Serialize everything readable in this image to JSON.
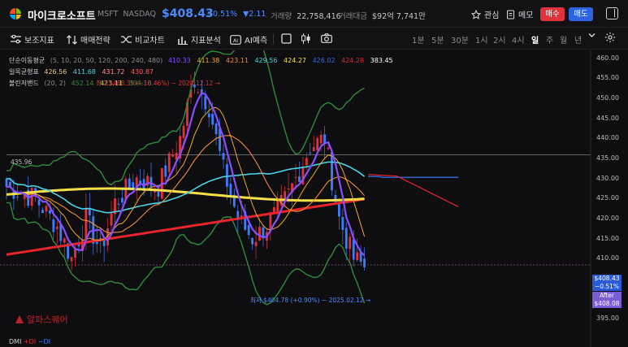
{
  "header": {
    "name": "마이크로소프트",
    "symbol": "MSFT",
    "exchange": "NASDAQ",
    "price": "$408.43",
    "change_pct": "−0.51%",
    "change_abs": "▼2.11",
    "volume_label": "거래량",
    "volume_value": "22,758,416",
    "amount_label": "거래대금",
    "amount_value": "$92억 7,741만",
    "watch_label": "관심",
    "memo_label": "메모",
    "buy_label": "매수",
    "sell_label": "매도"
  },
  "toolbar": {
    "aux_indicator": "보조지표",
    "trade_strategy": "매매전략",
    "compare_chart": "비교차트",
    "indicator_analysis": "지표분석",
    "ai_forecast": "AI예측",
    "timeframes": [
      "1분",
      "5분",
      "30분",
      "1시",
      "2시",
      "4시",
      "일",
      "주",
      "월",
      "년"
    ],
    "active_timeframe": "일"
  },
  "legend": {
    "sma": {
      "name": "단순이동평균",
      "params": "(5, 10, 20, 50, 120, 200, 240, 480)",
      "values": [
        "410.33",
        "411.38",
        "423.11",
        "429.56",
        "424.27",
        "426.02",
        "424.28",
        "383.45"
      ]
    },
    "ichimoku": {
      "name": "일목균형표",
      "values": [
        "426.56",
        "411.68",
        "431.72",
        "430.87"
      ]
    },
    "bollinger": {
      "name": "볼린저밴드",
      "params": "(20, 2)",
      "values": [
        "452.14",
        "423.11",
        "394.18"
      ]
    }
  },
  "colors": {
    "up": "#e0323a",
    "down": "#3b7dff",
    "sma": [
      "#8a4dff",
      "#f5a623",
      "#f08c3a",
      "#49d3e6",
      "#f5e04a",
      "#2f6bd8",
      "#e8252b",
      "#ffffff"
    ],
    "ichimoku": [
      "#e8c96a",
      "#49d3e6",
      "#ff9090",
      "#ff5a5a"
    ],
    "bollinger": [
      "#2e8b3a",
      "#c8d65a",
      "#2e8b3a"
    ]
  },
  "chart_data": {
    "type": "candlestick",
    "y_ticks": [
      "460.00",
      "455.00",
      "450.00",
      "445.00",
      "440.00",
      "435.00",
      "430.00",
      "425.00",
      "420.00",
      "415.00",
      "410.00",
      "405.00",
      "400.00",
      "395.00"
    ],
    "ylim": [
      393,
      462
    ],
    "reference_line": "435.96",
    "high_annotation": "최고 $468.35 (−10.46%) − 2024.12.12 →",
    "low_annotation": "최저 $404.78 (+0.90%) − 2025.02.12 →",
    "last_price_label": "$408.43",
    "last_change_label": "−0.51%",
    "after_label": "After",
    "after_price": "$408.08"
  },
  "watermark": "알파스퀘어",
  "dmi": {
    "label": "DMI",
    "plus": "+DI",
    "minus": "−DI"
  }
}
